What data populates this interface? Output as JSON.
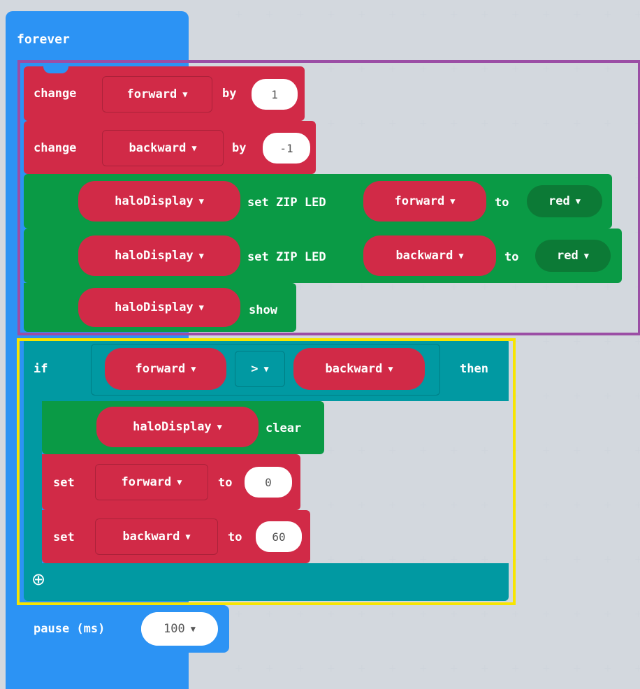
{
  "forever": {
    "label": "forever"
  },
  "change1": {
    "label": "change",
    "variable": "forward",
    "by": "by",
    "value": "1"
  },
  "change2": {
    "label": "change",
    "variable": "backward",
    "by": "by",
    "value": "-1"
  },
  "zip1": {
    "target": "haloDisplay",
    "label": "set ZIP LED",
    "index": "forward",
    "to": "to",
    "color": "red"
  },
  "zip2": {
    "target": "haloDisplay",
    "label": "set ZIP LED",
    "index": "backward",
    "to": "to",
    "color": "red"
  },
  "show": {
    "target": "haloDisplay",
    "label": "show"
  },
  "if_block": {
    "if": "if",
    "left": "forward",
    "op": ">",
    "right": "backward",
    "then": "then"
  },
  "clear": {
    "target": "haloDisplay",
    "label": "clear"
  },
  "set1": {
    "label": "set",
    "variable": "forward",
    "to": "to",
    "value": "0"
  },
  "set2": {
    "label": "set",
    "variable": "backward",
    "to": "to",
    "value": "60"
  },
  "pause": {
    "label": "pause (ms)",
    "value": "100"
  },
  "caret": "▼",
  "plus_icon": "⊕",
  "colors": {
    "loops": "#2c93f4",
    "variables": "#d12a47",
    "neopixel": "#0a9a45",
    "logic": "#0199a2",
    "purple_frame": "#9b4ea5",
    "yellow_frame": "#f7e500"
  }
}
